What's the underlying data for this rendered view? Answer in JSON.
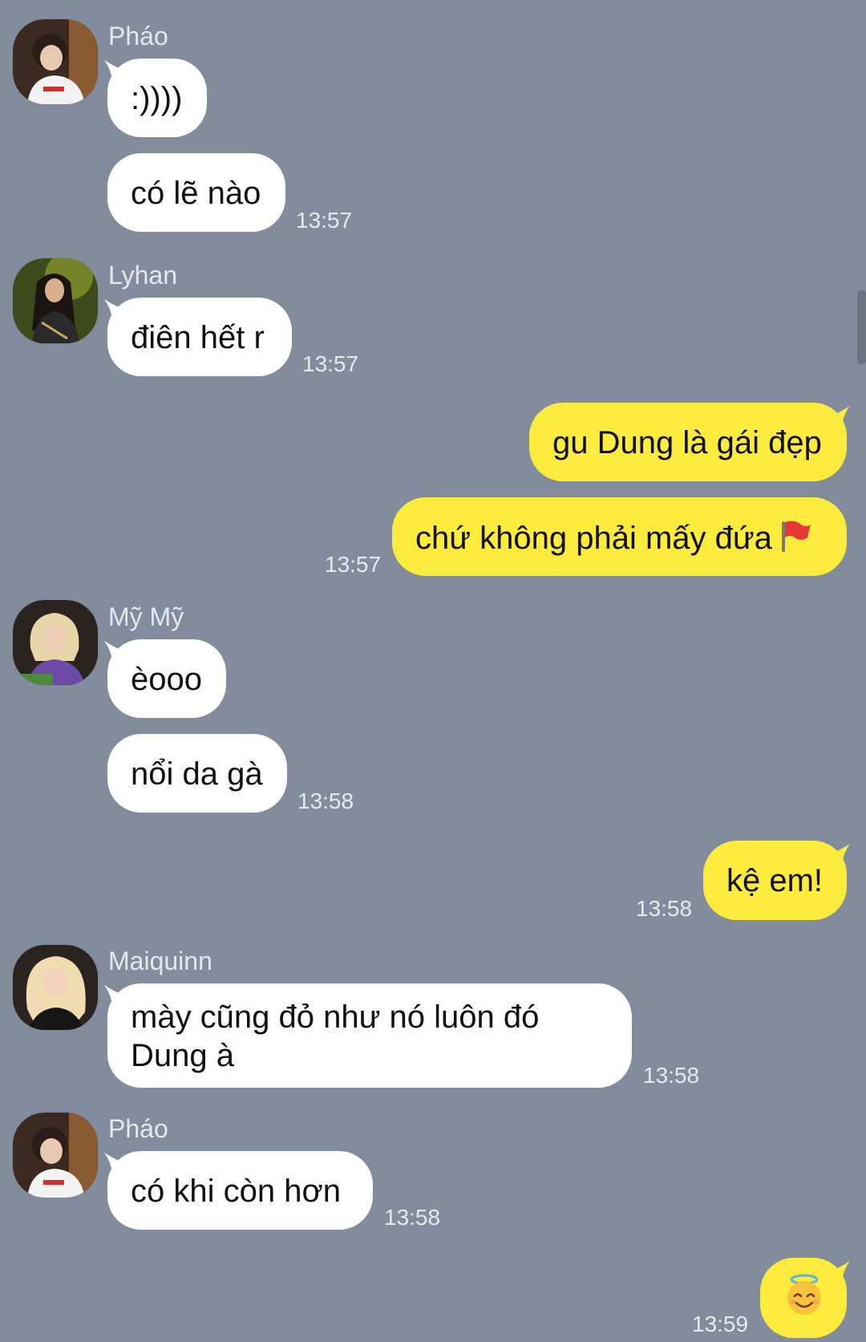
{
  "chat": {
    "groups": [
      {
        "sender": "Pháo",
        "messages": [
          ":))))",
          "có lẽ nào"
        ],
        "time": "13:57"
      },
      {
        "sender": "Lyhan",
        "messages": [
          "điên hết r"
        ],
        "time": "13:57"
      },
      {
        "outgoing": [
          "gu Dung là gái đẹp",
          "chứ không phải mấy đứa"
        ],
        "time": "13:57",
        "emoji": "red-flag-icon"
      },
      {
        "sender": "Mỹ Mỹ",
        "messages": [
          "èooo",
          "nổi da gà"
        ],
        "time": "13:58"
      },
      {
        "outgoing": [
          "kệ em!"
        ],
        "time": "13:58"
      },
      {
        "sender": "Maiquinn",
        "messages": [
          "mày cũng đỏ như nó luôn đó Dung à"
        ],
        "time": "13:58"
      },
      {
        "sender": "Pháo",
        "messages": [
          "có khi còn hơn"
        ],
        "time": "13:58"
      },
      {
        "outgoing_emoji": "smiling-face-with-halo-icon",
        "time": "13:59"
      }
    ]
  },
  "colors": {
    "background": "#828c9c",
    "incoming_bubble": "#ffffff",
    "outgoing_bubble": "#fbeb3c",
    "sender_name": "#e4e8ee",
    "timestamp": "#e6eaef"
  }
}
